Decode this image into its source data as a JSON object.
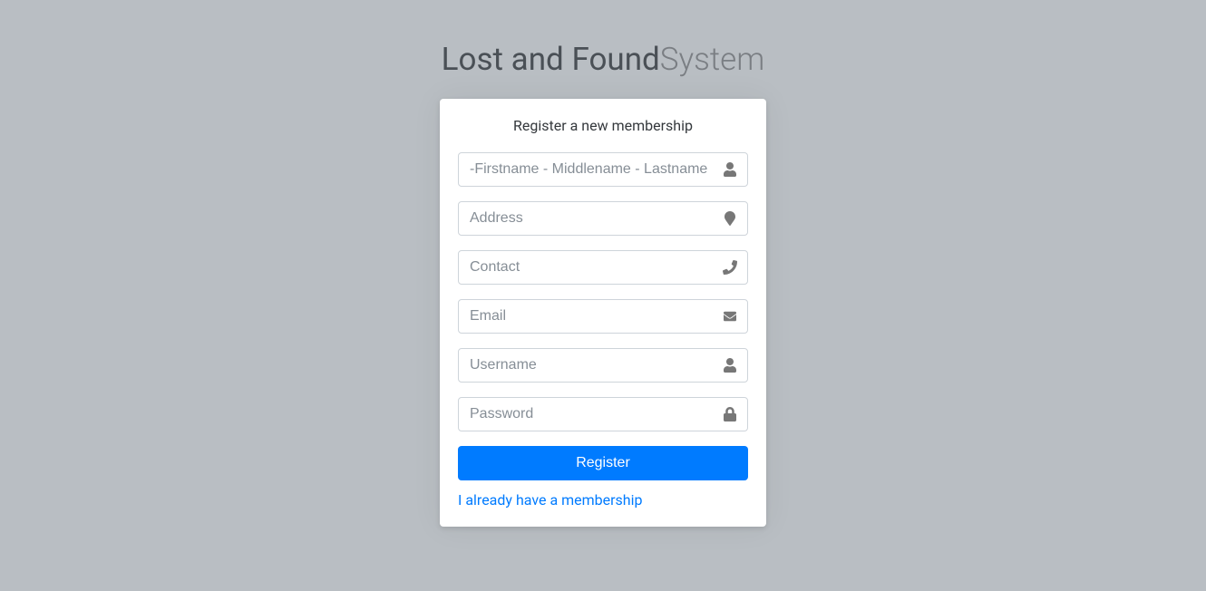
{
  "logo": {
    "strong": "Lost and Found",
    "light": "System"
  },
  "card": {
    "message": "Register a new membership",
    "fields": {
      "fullname": {
        "placeholder": "-Firstname - Middlename - Lastname",
        "value": ""
      },
      "address": {
        "placeholder": "Address",
        "value": ""
      },
      "contact": {
        "placeholder": "Contact",
        "value": ""
      },
      "email": {
        "placeholder": "Email",
        "value": ""
      },
      "username": {
        "placeholder": "Username",
        "value": ""
      },
      "password": {
        "placeholder": "Password",
        "value": ""
      }
    },
    "submit_label": "Register",
    "alt_link_label": "I already have a membership"
  }
}
